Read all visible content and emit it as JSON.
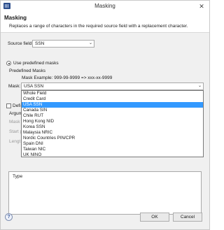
{
  "window": {
    "title": "Masking",
    "close_glyph": "✕"
  },
  "header": {
    "title": "Masking",
    "description": "Replaces a range of characters in the required source field with a replacement character."
  },
  "source_field": {
    "label": "Source field:",
    "value": "SSN"
  },
  "predefined": {
    "radio_label": "Use predefined masks",
    "section_label": "Predefined Masks",
    "example": "Mask Example: 999-99-9999 => xxx-xx-9999",
    "mask_label": "Mask:",
    "mask_value": "USA SSN",
    "options": [
      "Whole Field",
      "Credit Card",
      "USA SSN",
      "Canada SIN",
      "Chile RUT",
      "Hong Kong NID",
      "Korea SSN",
      "Malaysia NRIC",
      "Nordic Countries PIN/CPR",
      "Spain DNI",
      "Taiwan NIC",
      "UK NINO"
    ],
    "selected_option": "USA SSN"
  },
  "define": {
    "label": "Defi",
    "args_label": "Argum",
    "mask_label": "Mask",
    "start_label": "Start p",
    "length_label": "Lengt"
  },
  "table": {
    "column_type": "Type"
  },
  "buttons": {
    "ok": "OK",
    "cancel": "Cancel",
    "help_glyph": "?"
  }
}
